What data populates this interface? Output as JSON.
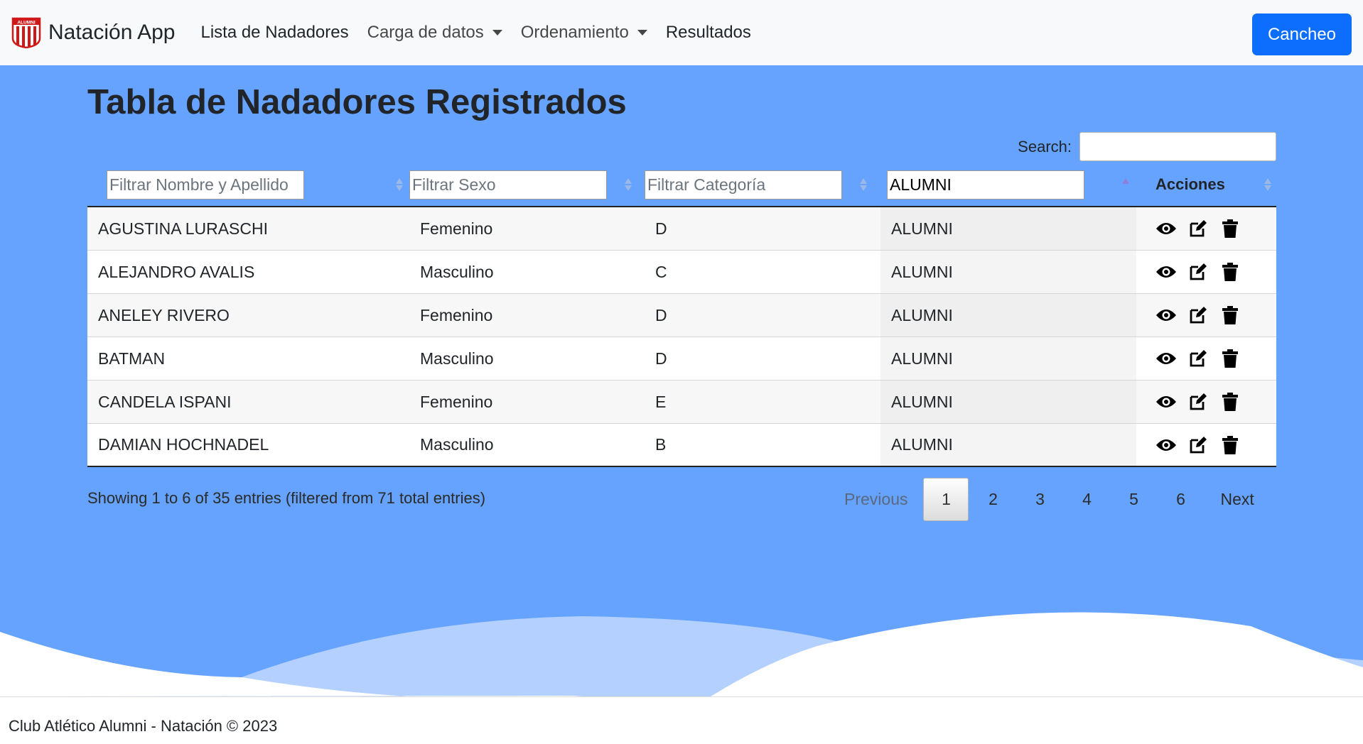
{
  "navbar": {
    "brand": "Natación App",
    "logo_text": "ALUMNI",
    "items": [
      {
        "label": "Lista de Nadadores"
      },
      {
        "label": "Carga de datos"
      },
      {
        "label": "Ordenamiento"
      },
      {
        "label": "Resultados"
      }
    ],
    "button": "Cancheo"
  },
  "page": {
    "title": "Tabla de Nadadores Registrados"
  },
  "search": {
    "label": "Search:",
    "value": ""
  },
  "table": {
    "filters": {
      "name_placeholder": "Filtrar Nombre y Apellido",
      "sex_placeholder": "Filtrar Sexo",
      "category_placeholder": "Filtrar Categoría",
      "club_value": "ALUMNI"
    },
    "actions_header": "Acciones",
    "rows": [
      {
        "name": "AGUSTINA LURASCHI",
        "sex": "Femenino",
        "category": "D",
        "club": "ALUMNI"
      },
      {
        "name": "ALEJANDRO AVALIS",
        "sex": "Masculino",
        "category": "C",
        "club": "ALUMNI"
      },
      {
        "name": "ANELEY RIVERO",
        "sex": "Femenino",
        "category": "D",
        "club": "ALUMNI"
      },
      {
        "name": "BATMAN",
        "sex": "Masculino",
        "category": "D",
        "club": "ALUMNI"
      },
      {
        "name": "CANDELA ISPANI",
        "sex": "Femenino",
        "category": "E",
        "club": "ALUMNI"
      },
      {
        "name": "DAMIAN HOCHNADEL",
        "sex": "Masculino",
        "category": "B",
        "club": "ALUMNI"
      }
    ],
    "info": "Showing 1 to 6 of 35 entries (filtered from 71 total entries)"
  },
  "pagination": {
    "previous": "Previous",
    "next": "Next",
    "pages": [
      "1",
      "2",
      "3",
      "4",
      "5",
      "6"
    ],
    "current": "1"
  },
  "footer": {
    "text": "Club Atlético Alumni - Natación © 2023"
  },
  "colors": {
    "main_bg": "#66a3ff",
    "primary_button": "#0d6efd",
    "navbar_bg": "#f8f9fa"
  }
}
